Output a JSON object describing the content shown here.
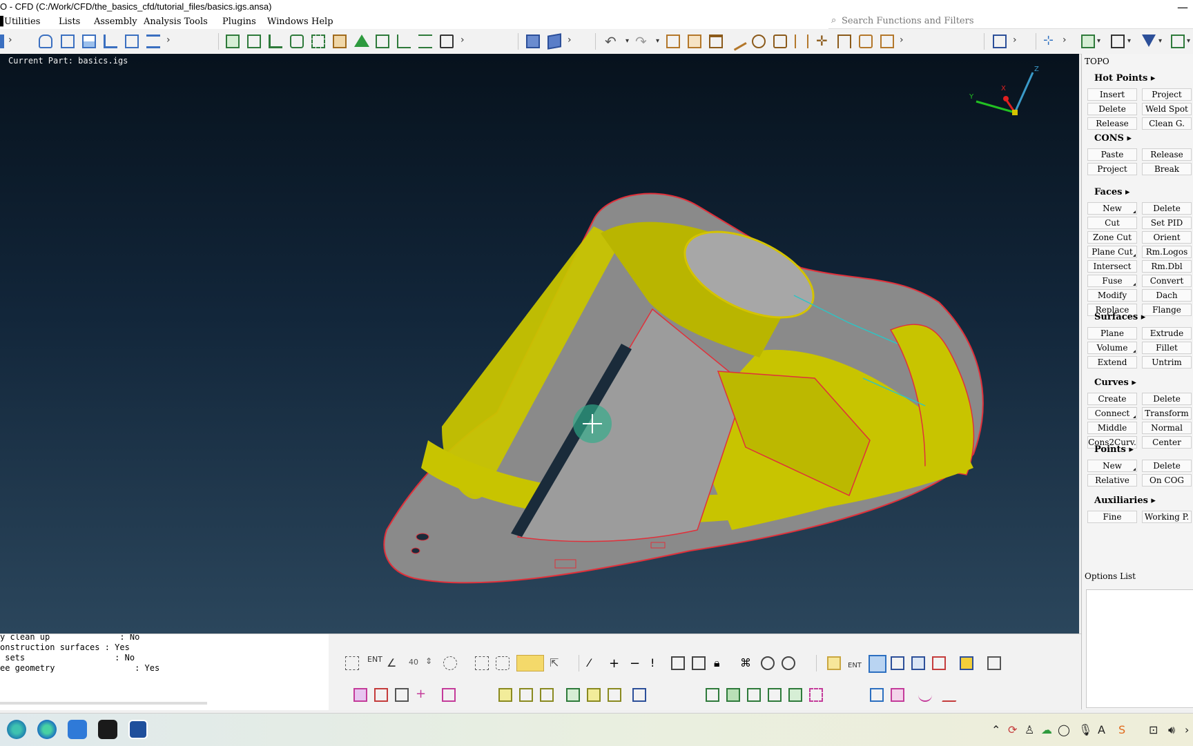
{
  "window": {
    "title": "O - CFD (C:/Work/CFD/the_basics_cfd/tutorial_files/basics.igs.ansa)",
    "close": "—"
  },
  "menu": [
    "Utilities",
    "Lists",
    "Assembly",
    "Analysis Tools",
    "Plugins",
    "Windows",
    "Help"
  ],
  "search": {
    "placeholder": "Search Functions and Filters",
    "icon": "search-icon"
  },
  "viewport": {
    "current_part": "Current Part: basics.igs",
    "axes": {
      "x": "X",
      "y": "Y",
      "z": "Z"
    }
  },
  "topo": {
    "title": "TOPO",
    "sections": [
      {
        "name": "Hot Points ▸",
        "buttons": [
          "Insert",
          "Project",
          "Delete",
          "Weld Spot",
          "Release",
          "Clean G."
        ]
      },
      {
        "name": "CONS ▸",
        "buttons": [
          "Paste",
          "Release",
          "Project",
          "Break"
        ]
      },
      {
        "name": "Faces ▸",
        "buttons": [
          "New",
          "Delete",
          "Cut",
          "Set PID",
          "Zone Cut",
          "Orient",
          "Plane Cut",
          "Rm.Logos",
          "Intersect",
          "Rm.Dbl",
          "Fuse",
          "Convert",
          "Modify",
          "Dach",
          "Replace",
          "Flange"
        ]
      },
      {
        "name": "Surfaces ▸",
        "buttons": [
          "Plane",
          "Extrude",
          "Volume",
          "Fillet",
          "Extend",
          "Untrim"
        ]
      },
      {
        "name": "Curves ▸",
        "buttons": [
          "Create",
          "Delete",
          "Connect",
          "Transform",
          "Middle",
          "Normal",
          "Cons2Curv.",
          "Center"
        ]
      },
      {
        "name": "Points ▸",
        "buttons": [
          "New",
          "Delete",
          "Relative",
          "On COG"
        ]
      },
      {
        "name": "Auxiliaries ▸",
        "buttons": [
          "Fine",
          "Working P."
        ]
      }
    ]
  },
  "options": {
    "title": "Options List"
  },
  "console": {
    "lines": [
      "y clean up              : No",
      "onstruction surfaces : Yes",
      " sets                  : No",
      "ee geometry                : Yes"
    ]
  },
  "bottom_toolbar": {
    "ent_label": "ENT",
    "angle_value": "40",
    "ent_label2": "ENT"
  },
  "colors": {
    "geometry_yellow": "#c8c400",
    "geometry_gray": "#8f8f8f",
    "edge_red": "#e0303a",
    "edge_cyan": "#2ec4c4",
    "panel": "#f4f4f4"
  },
  "taskbar": {
    "apps": [
      "edge-dev-icon",
      "edge-icon",
      "mail-icon",
      "terminal-icon",
      "ansa-icon"
    ]
  }
}
